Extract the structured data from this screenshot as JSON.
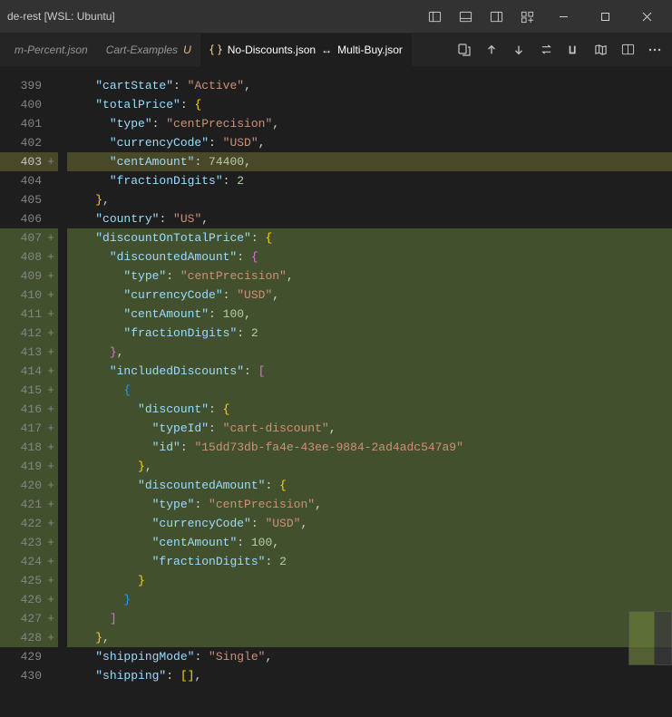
{
  "window": {
    "title_suffix": "de-rest [WSL: Ubuntu]"
  },
  "tabs": {
    "left1": "m-Percent.json",
    "left2": "Cart-Examples",
    "left2_mod": "U",
    "active_prefix": "No-Discounts.json",
    "active_sep": "↔",
    "active_suffix": "Multi-Buy.jsor"
  },
  "lines": [
    {
      "num": "399",
      "added": false,
      "hl": "",
      "html": "    <span class='tok-key'>\"cartState\"</span><span class='tok-punc'>: </span><span class='tok-str'>\"Active\"</span><span class='tok-punc'>,</span>"
    },
    {
      "num": "400",
      "added": false,
      "hl": "",
      "html": "    <span class='tok-key'>\"totalPrice\"</span><span class='tok-punc'>: </span><span class='tok-brace-y'>{</span>"
    },
    {
      "num": "401",
      "added": false,
      "hl": "",
      "html": "      <span class='tok-key'>\"type\"</span><span class='tok-punc'>: </span><span class='tok-str'>\"centPrecision\"</span><span class='tok-punc'>,</span>"
    },
    {
      "num": "402",
      "added": false,
      "hl": "",
      "html": "      <span class='tok-key'>\"currencyCode\"</span><span class='tok-punc'>: </span><span class='tok-str'>\"USD\"</span><span class='tok-punc'>,</span>"
    },
    {
      "num": "403",
      "added": true,
      "hl": "mod",
      "current": true,
      "html": "      <span class='tok-key'>\"centAmount\"</span><span class='tok-punc'>: </span><span class='tok-num'>74400</span><span class='tok-punc'>,</span>"
    },
    {
      "num": "404",
      "added": false,
      "hl": "",
      "html": "      <span class='tok-key'>\"fractionDigits\"</span><span class='tok-punc'>: </span><span class='tok-num'>2</span>"
    },
    {
      "num": "405",
      "added": false,
      "hl": "",
      "html": "    <span class='tok-brace-y'>}</span><span class='tok-punc'>,</span>"
    },
    {
      "num": "406",
      "added": false,
      "hl": "",
      "html": "    <span class='tok-key'>\"country\"</span><span class='tok-punc'>: </span><span class='tok-str'>\"US\"</span><span class='tok-punc'>,</span>"
    },
    {
      "num": "407",
      "added": true,
      "hl": "add",
      "html": "    <span class='tok-key'>\"discountOnTotalPrice\"</span><span class='tok-punc'>: </span><span class='tok-brace-y'>{</span>"
    },
    {
      "num": "408",
      "added": true,
      "hl": "add",
      "html": "      <span class='tok-key'>\"discountedAmount\"</span><span class='tok-punc'>: </span><span class='tok-brace-p'>{</span>"
    },
    {
      "num": "409",
      "added": true,
      "hl": "add",
      "html": "        <span class='tok-key'>\"type\"</span><span class='tok-punc'>: </span><span class='tok-str'>\"centPrecision\"</span><span class='tok-punc'>,</span>"
    },
    {
      "num": "410",
      "added": true,
      "hl": "add",
      "html": "        <span class='tok-key'>\"currencyCode\"</span><span class='tok-punc'>: </span><span class='tok-str'>\"USD\"</span><span class='tok-punc'>,</span>"
    },
    {
      "num": "411",
      "added": true,
      "hl": "add",
      "html": "        <span class='tok-key'>\"centAmount\"</span><span class='tok-punc'>: </span><span class='tok-num'>100</span><span class='tok-punc'>,</span>"
    },
    {
      "num": "412",
      "added": true,
      "hl": "add",
      "html": "        <span class='tok-key'>\"fractionDigits\"</span><span class='tok-punc'>: </span><span class='tok-num'>2</span>"
    },
    {
      "num": "413",
      "added": true,
      "hl": "add",
      "html": "      <span class='tok-brace-p'>}</span><span class='tok-punc'>,</span>"
    },
    {
      "num": "414",
      "added": true,
      "hl": "add",
      "html": "      <span class='tok-key'>\"includedDiscounts\"</span><span class='tok-punc'>: </span><span class='tok-brace-p'>[</span>"
    },
    {
      "num": "415",
      "added": true,
      "hl": "add",
      "html": "        <span class='tok-brace-b'>{</span>"
    },
    {
      "num": "416",
      "added": true,
      "hl": "add",
      "html": "          <span class='tok-key'>\"discount\"</span><span class='tok-punc'>: </span><span class='tok-brace-y'>{</span>"
    },
    {
      "num": "417",
      "added": true,
      "hl": "add",
      "html": "            <span class='tok-key'>\"typeId\"</span><span class='tok-punc'>: </span><span class='tok-str'>\"cart-discount\"</span><span class='tok-punc'>,</span>"
    },
    {
      "num": "418",
      "added": true,
      "hl": "add",
      "html": "            <span class='tok-key'>\"id\"</span><span class='tok-punc'>: </span><span class='tok-str'>\"15dd73db-fa4e-43ee-9884-2ad4adc547a9\"</span>"
    },
    {
      "num": "419",
      "added": true,
      "hl": "add",
      "html": "          <span class='tok-brace-y'>}</span><span class='tok-punc'>,</span>"
    },
    {
      "num": "420",
      "added": true,
      "hl": "add",
      "html": "          <span class='tok-key'>\"discountedAmount\"</span><span class='tok-punc'>: </span><span class='tok-brace-y'>{</span>"
    },
    {
      "num": "421",
      "added": true,
      "hl": "add",
      "html": "            <span class='tok-key'>\"type\"</span><span class='tok-punc'>: </span><span class='tok-str'>\"centPrecision\"</span><span class='tok-punc'>,</span>"
    },
    {
      "num": "422",
      "added": true,
      "hl": "add",
      "html": "            <span class='tok-key'>\"currencyCode\"</span><span class='tok-punc'>: </span><span class='tok-str'>\"USD\"</span><span class='tok-punc'>,</span>"
    },
    {
      "num": "423",
      "added": true,
      "hl": "add",
      "html": "            <span class='tok-key'>\"centAmount\"</span><span class='tok-punc'>: </span><span class='tok-num'>100</span><span class='tok-punc'>,</span>"
    },
    {
      "num": "424",
      "added": true,
      "hl": "add",
      "html": "            <span class='tok-key'>\"fractionDigits\"</span><span class='tok-punc'>: </span><span class='tok-num'>2</span>"
    },
    {
      "num": "425",
      "added": true,
      "hl": "add",
      "html": "          <span class='tok-brace-y'>}</span>"
    },
    {
      "num": "426",
      "added": true,
      "hl": "add",
      "html": "        <span class='tok-brace-b'>}</span>"
    },
    {
      "num": "427",
      "added": true,
      "hl": "add",
      "html": "      <span class='tok-brace-p'>]</span>"
    },
    {
      "num": "428",
      "added": true,
      "hl": "add",
      "html": "    <span class='tok-brace-y'>}</span><span class='tok-punc'>,</span>"
    },
    {
      "num": "429",
      "added": false,
      "hl": "",
      "html": "    <span class='tok-key'>\"shippingMode\"</span><span class='tok-punc'>: </span><span class='tok-str'>\"Single\"</span><span class='tok-punc'>,</span>"
    },
    {
      "num": "430",
      "added": false,
      "hl": "",
      "html": "    <span class='tok-key'>\"shipping\"</span><span class='tok-punc'>: </span><span class='tok-brace-y'>[</span><span class='tok-brace-y'>]</span><span class='tok-punc'>,</span>"
    }
  ]
}
